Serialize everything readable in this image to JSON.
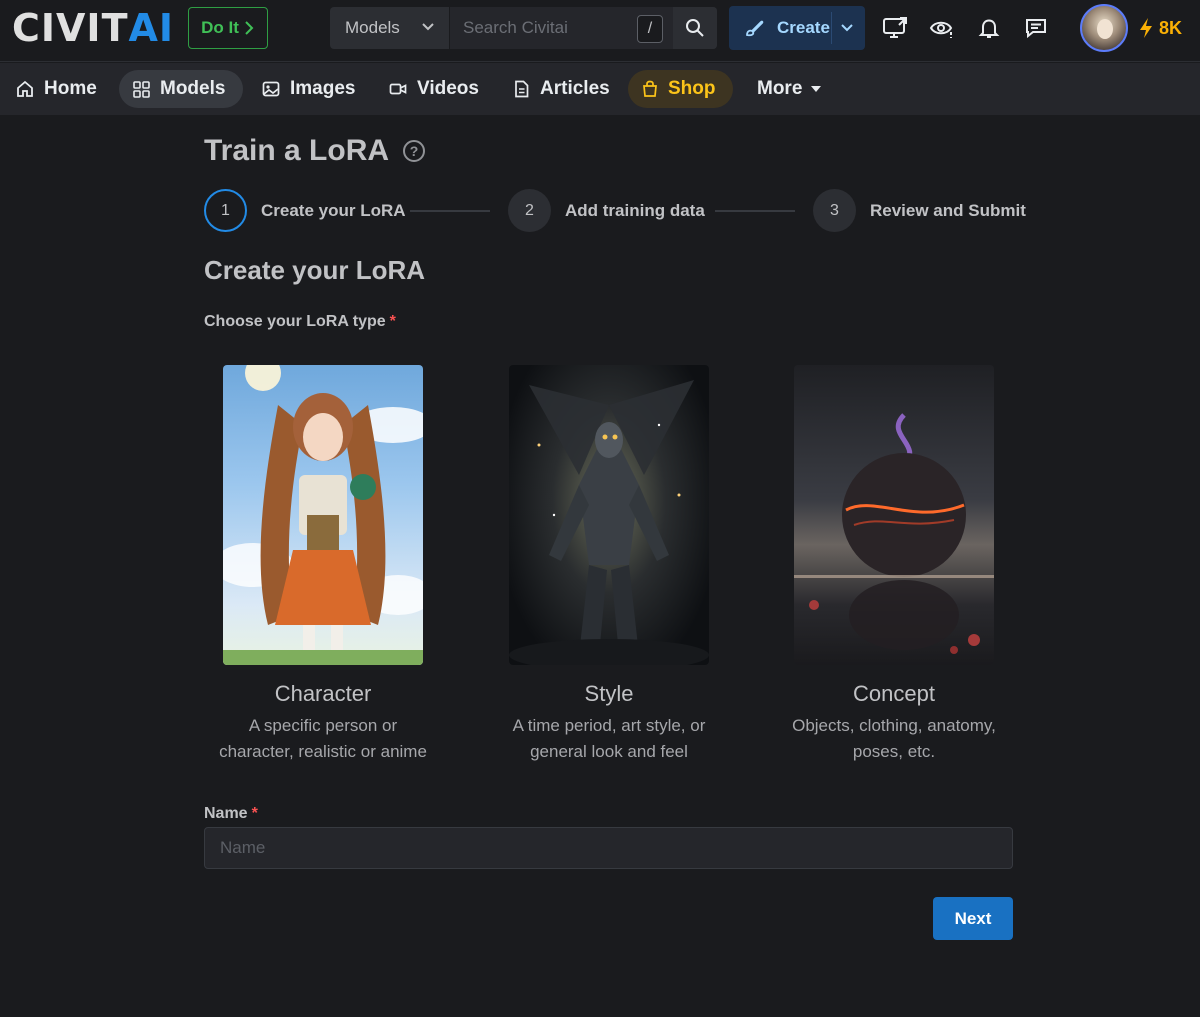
{
  "header": {
    "logo_main": "CIVIT",
    "logo_accent": "AI",
    "doit_label": "Do It",
    "search_scope": "Models",
    "search_placeholder": "Search Civitai",
    "search_shortcut": "/",
    "create_label": "Create",
    "buzz_amount": "8K",
    "brand_blue": "#228be6",
    "buzz_color": "#fab005"
  },
  "nav": {
    "items": [
      {
        "label": "Home",
        "icon": "home-icon"
      },
      {
        "label": "Models",
        "icon": "grid-icon"
      },
      {
        "label": "Images",
        "icon": "image-icon"
      },
      {
        "label": "Videos",
        "icon": "video-icon"
      },
      {
        "label": "Articles",
        "icon": "article-icon"
      },
      {
        "label": "Shop",
        "icon": "bag-icon"
      },
      {
        "label": "More",
        "icon": "caret-down-icon"
      }
    ]
  },
  "page": {
    "title": "Train a LoRA",
    "help": "?",
    "steps": [
      {
        "number": "1",
        "label": "Create your LoRA"
      },
      {
        "number": "2",
        "label": "Add training data"
      },
      {
        "number": "3",
        "label": "Review and Submit"
      }
    ],
    "section_title": "Create your LoRA",
    "type_label": "Choose your LoRA type",
    "required_mark": "*",
    "types": [
      {
        "title": "Character",
        "desc_line1": "A specific person or",
        "desc_line2": "character, realistic or anime"
      },
      {
        "title": "Style",
        "desc_line1": "A time period, art style, or",
        "desc_line2": "general look and feel"
      },
      {
        "title": "Concept",
        "desc_line1": "Objects, clothing, anatomy,",
        "desc_line2": "poses, etc."
      }
    ],
    "name_label": "Name",
    "name_placeholder": "Name",
    "next_label": "Next"
  }
}
